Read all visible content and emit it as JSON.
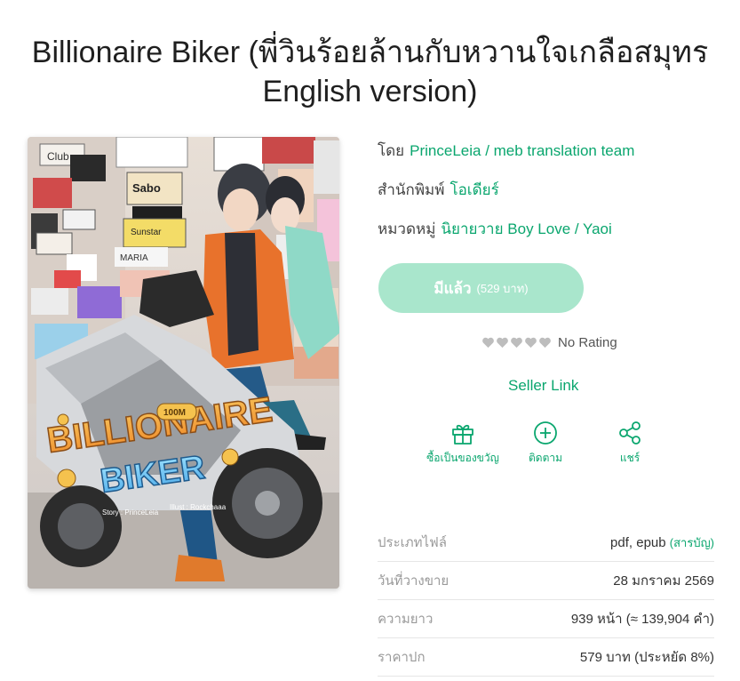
{
  "book": {
    "title_line1": "Billionaire Biker (พี่วินร้อยล้านกับหวานใจเกลือสมุทร",
    "title_line2": "English version)",
    "cover": {
      "logo_line1": "BILLIONAIRE",
      "logo_line2": "BIKER",
      "credit_story": "Story : PrinceLeia",
      "credit_illust": "Illust : Rockchaaa",
      "sign_club": "Club",
      "sign_sabo": "Sabo",
      "sign_sunstar": "Sunstar",
      "sign_maria": "MARIA",
      "sign_100m": "100M"
    }
  },
  "meta": {
    "author_label": "โดย",
    "author_value": "PrinceLeia / meb translation team",
    "publisher_label": "สำนักพิมพ์",
    "publisher_value": "โอเดียร์",
    "category_label": "หมวดหมู่",
    "category_value": "นิยายวาย Boy Love / Yaoi"
  },
  "buy": {
    "label": "มีแล้ว",
    "price": "(529 บาท)"
  },
  "rating": {
    "text": "No Rating"
  },
  "seller_link": "Seller Link",
  "actions": {
    "gift": "ซื้อเป็นของขวัญ",
    "follow": "ติดตาม",
    "share": "แชร์"
  },
  "info": {
    "rows": [
      {
        "key": "ประเภทไฟล์",
        "value": "pdf, epub",
        "extra": "(สารบัญ)"
      },
      {
        "key": "วันที่วางขาย",
        "value": "28 มกราคม 2569",
        "extra": ""
      },
      {
        "key": "ความยาว",
        "value": "939 หน้า (≈ 139,904 คำ)",
        "extra": ""
      },
      {
        "key": "ราคาปก",
        "value": "579 บาท (ประหยัด 8%)",
        "extra": ""
      }
    ]
  },
  "colors": {
    "accent": "#0aa66e",
    "button_bg": "#a9e6cc",
    "heart_gray": "#bdbdbd"
  }
}
